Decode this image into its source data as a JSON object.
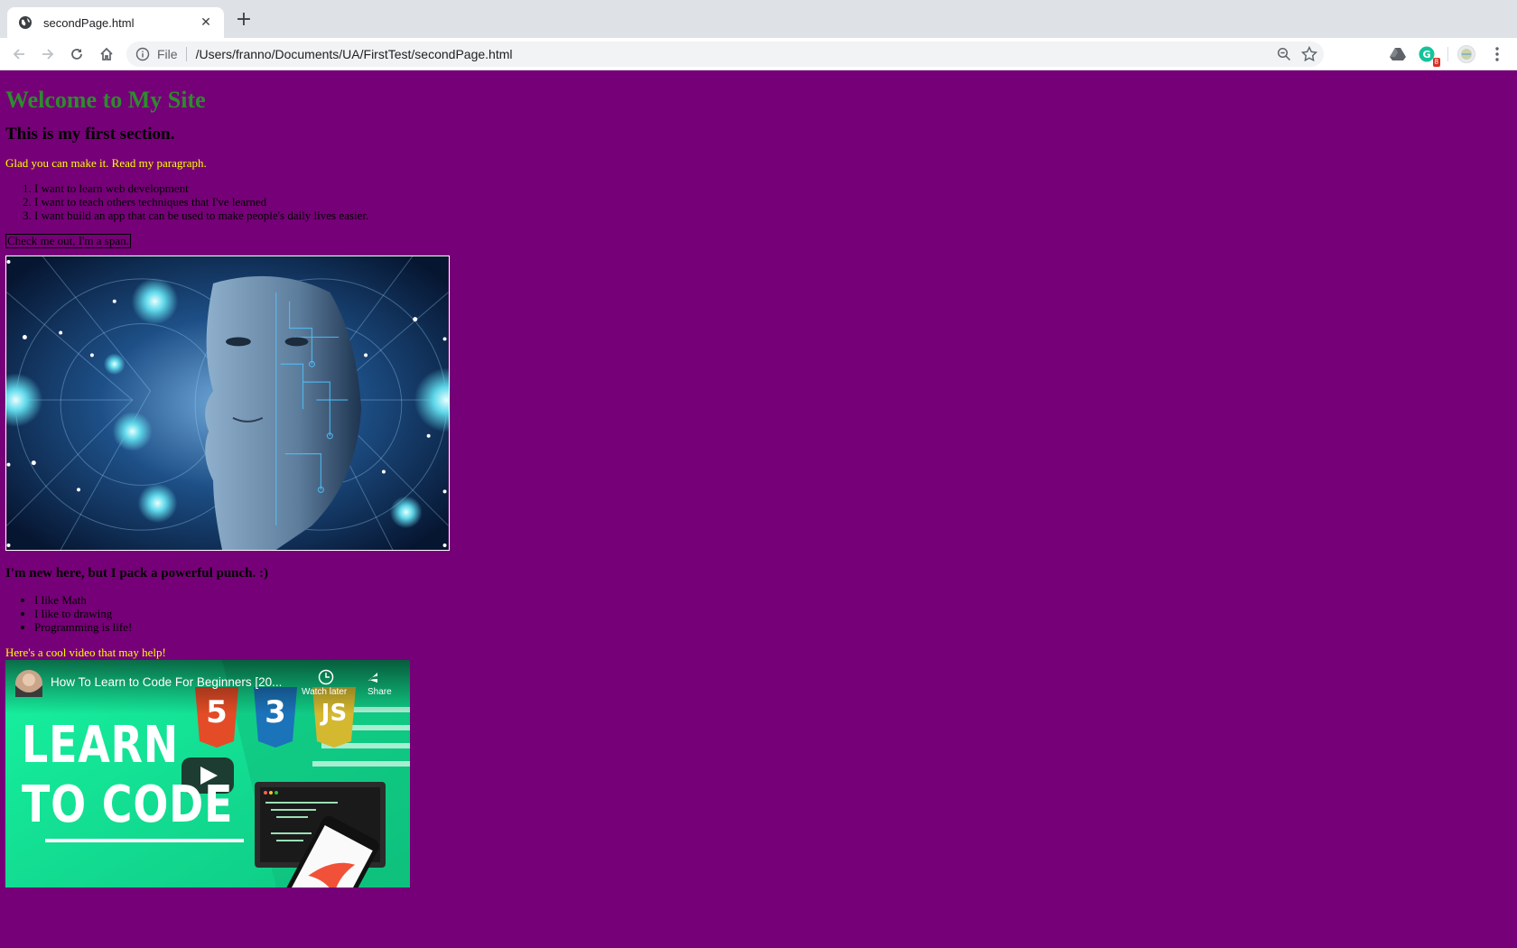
{
  "browser": {
    "tab_title": "secondPage.html",
    "scheme_label": "File",
    "url": "/Users/franno/Documents/UA/FirstTest/secondPage.html",
    "extension_badge": "8",
    "icons": [
      "globe-icon",
      "close-icon",
      "plus-icon",
      "back-arrow-icon",
      "forward-arrow-icon",
      "reload-icon",
      "home-icon",
      "info-icon",
      "zoom-out-icon",
      "star-icon",
      "drive-icon",
      "grammarly-icon",
      "profile-avatar",
      "kebab-menu-icon"
    ]
  },
  "page": {
    "heading": "Welcome to My Site",
    "section_heading": "This is my first section.",
    "intro_paragraph": "Glad you can make it. Read my paragraph.",
    "ordered_list": [
      "I want to learn web development",
      "I want to teach others techniques that I've learned",
      "I want build an app that can be used to make people's daily lives easier."
    ],
    "span_text": "Check me out, I'm a span.",
    "subheading": "I'm new here, but I pack a powerful punch. :)",
    "unordered_list": [
      "I like Math",
      "I like to drawing",
      "Programming is life!"
    ],
    "video_intro": "Here's a cool video that may help!",
    "video": {
      "title": "How To Learn to Code For Beginners [20...",
      "watch_later": "Watch later",
      "share": "Share",
      "thumbnail_text_line1": "LEARN",
      "thumbnail_text_line2": "TO CODE",
      "badges": [
        "5",
        "3",
        "JS"
      ]
    }
  },
  "colors": {
    "background": "#760077",
    "heading": "#2e8b2e",
    "highlight_text": "#ffff00"
  }
}
